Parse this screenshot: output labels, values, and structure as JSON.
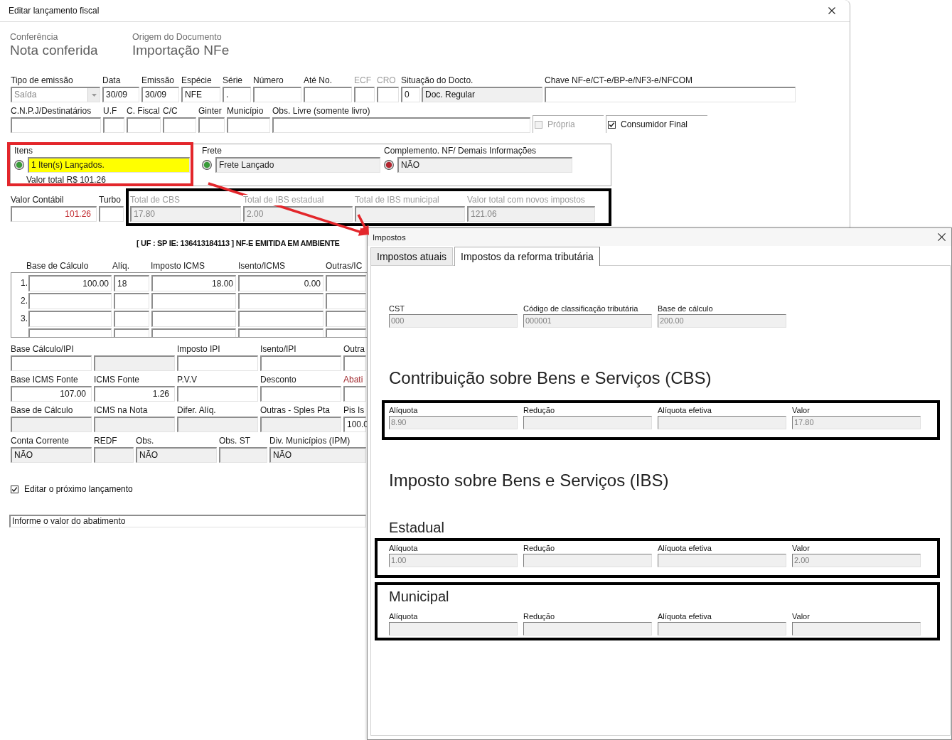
{
  "main_window": {
    "title": "Editar lançamento fiscal",
    "header": [
      {
        "label": "Conferência",
        "value": "Nota conferida"
      },
      {
        "label": "Origem do Documento",
        "value": "Importação NFe"
      }
    ],
    "row_1": [
      {
        "label": "Tipo de emissão",
        "kind": "combo",
        "value": "Saída",
        "disabled": true
      },
      {
        "label": "Data",
        "kind": "input",
        "value": "30/09",
        "disabled": false
      },
      {
        "label": "Emissão",
        "kind": "input",
        "value": "30/09",
        "disabled": false
      },
      {
        "label": "Espécie",
        "kind": "input",
        "value": "NFE",
        "disabled": false
      },
      {
        "label": "Série",
        "kind": "input",
        "value": ".",
        "disabled": false
      },
      {
        "label": "Número",
        "kind": "input",
        "disabled": false
      },
      {
        "label": "Até No.",
        "kind": "input",
        "disabled": false
      },
      {
        "label": "ECF",
        "kind": "input",
        "disabled": true
      },
      {
        "label": "CRO",
        "kind": "input",
        "disabled": true
      },
      {
        "label": "Situação do Docto.",
        "kind": "pair",
        "value": "0",
        "detail": "Doc. Regular",
        "disabled": false
      },
      {
        "label": "Chave NF-e/CT-e/BP-e/NF3-e/NFCOM",
        "kind": "input",
        "disabled": false
      }
    ],
    "row_2": [
      {
        "label": "C.N.P.J/Destinatários",
        "kind": "input"
      },
      {
        "label": "U.F",
        "kind": "input"
      },
      {
        "label": "C. Fiscal",
        "kind": "input"
      },
      {
        "label": "C/C",
        "kind": "input"
      },
      {
        "label": "Ginter",
        "kind": "input"
      },
      {
        "label": "Município",
        "kind": "input"
      },
      {
        "label": "Obs. Livre (somente livro)",
        "kind": "input"
      }
    ],
    "checkboxes": [
      {
        "label": "Própria",
        "checked": false,
        "disabled": true
      },
      {
        "label": "Consumidor Final",
        "checked": true,
        "disabled": false
      }
    ],
    "launch_status": [
      {
        "label": "Itens",
        "value": "1 Iten(s) Lançados.",
        "color": "#3a9b3a",
        "highlighted": true,
        "note": "Valor total R$ 101.26",
        "boxed": true
      },
      {
        "label": "Frete",
        "value": "Frete Lançado",
        "color": "#3a9b3a",
        "highlighted": false,
        "boxed": false
      },
      {
        "label": "Complemento. NF/ Demais Informações",
        "value": "NÃO",
        "color": "#b32630",
        "highlighted": false,
        "boxed": false
      }
    ],
    "values_row": [
      {
        "label": "Valor Contábil",
        "kind": "number",
        "value": "101.26",
        "value_alert": true
      },
      {
        "label": "Turbo",
        "kind": "input"
      }
    ],
    "new_taxes": {
      "boxed": true,
      "fields": [
        {
          "label": "Total de CBS",
          "kind": "readonly",
          "value": "17.80",
          "disabled": true
        },
        {
          "label": "Total de IBS estadual",
          "kind": "readonly",
          "value": "2.00",
          "disabled": true
        },
        {
          "label": "Total de IBS municipal",
          "kind": "readonly",
          "disabled": true
        },
        {
          "label": "Valor total com novos impostos",
          "kind": "readonly",
          "value": "121.06",
          "disabled": true
        }
      ]
    },
    "notice": "[ UF : SP IE: 136413184113 ] NF-E EMITIDA EM AMBIENTE",
    "icms_table": {
      "columns": [
        "Base de Cálculo",
        "Alíq.",
        "Imposto ICMS",
        "Isento/ICMS",
        "Outras/IC"
      ],
      "rows": [
        {
          "number": "1.",
          "cells": [
            "100.00",
            "18",
            "18.00",
            "0.00"
          ],
          "clipped": false
        },
        {
          "number": "2.",
          "clipped": false
        },
        {
          "number": "3.",
          "clipped": false
        },
        {
          "clipped": true
        }
      ]
    },
    "lower_rows": [
      [
        {
          "label": "Base Cálculo/IPI",
          "kind": "input"
        },
        {
          "kind": "readonly"
        },
        {
          "label": "Imposto IPI",
          "kind": "input"
        },
        {
          "label": "Isento/IPI",
          "kind": "input"
        },
        {
          "label": "Outra",
          "kind": "input"
        }
      ],
      [
        {
          "label": "Base ICMS Fonte",
          "kind": "number",
          "value": "107.00",
          "label_alert": false
        },
        {
          "label": "ICMS Fonte",
          "kind": "number",
          "value": "1.26",
          "label_alert": false
        },
        {
          "label": "P.V.V",
          "kind": "input",
          "label_alert": false
        },
        {
          "label": "Desconto",
          "kind": "input",
          "label_alert": false
        },
        {
          "label": "Abati",
          "kind": "input",
          "label_alert": true
        }
      ],
      [
        {
          "label": "Base de Cálculo",
          "kind": "readonly"
        },
        {
          "label": "ICMS na Nota",
          "kind": "readonly"
        },
        {
          "label": "Difer. Alíq.",
          "kind": "readonly"
        },
        {
          "label": "Outras - Sples Pta",
          "kind": "readonly"
        },
        {
          "label": "Pis Is",
          "kind": "input",
          "value": "100.0"
        }
      ],
      [
        {
          "label": "Conta Corrente",
          "kind": "readonly",
          "value": "NÃO"
        },
        {
          "label": "REDF",
          "kind": "readonly"
        },
        {
          "label": "Obs.",
          "kind": "readonly",
          "value": "NÃO"
        },
        {
          "label": "Obs. ST",
          "kind": "readonly"
        },
        {
          "label": "Div. Municípios (IPM)",
          "kind": "readonly",
          "value": "NÃO"
        }
      ]
    ],
    "edit_next": {
      "label": "Editar o próximo lançamento",
      "checked": true
    },
    "status_bar": "Informe o valor do abatimento"
  },
  "taxes_window": {
    "title": "Impostos",
    "tabs": [
      {
        "label": "Impostos atuais",
        "selected": false
      },
      {
        "label": "Impostos da reforma tributária",
        "selected": true
      }
    ],
    "fields": [
      {
        "label": "CST",
        "value": "000",
        "disabled": true
      },
      {
        "label": "Código de classificação tributária",
        "value": "000001",
        "disabled": true
      },
      {
        "label": "Base de cálculo",
        "value": "200.00",
        "disabled": true
      }
    ],
    "sections": [
      {
        "title": "Contribuição sobre Bens e Serviços (CBS)",
        "blocks": [
          {
            "kind": "fields",
            "boxed": true,
            "fields": [
              {
                "label": "Alíquota",
                "value": "8.90",
                "disabled": true
              },
              {
                "label": "Redução",
                "disabled": true
              },
              {
                "label": "Alíquota efetiva",
                "disabled": true
              },
              {
                "label": "Valor",
                "value": "17.80",
                "disabled": true
              }
            ]
          }
        ]
      },
      {
        "title": "Imposto sobre Bens e Serviços (IBS)",
        "blocks": [
          {
            "kind": "subtitle",
            "text": "Estadual"
          },
          {
            "kind": "fields",
            "boxed": true,
            "fields": [
              {
                "label": "Alíquota",
                "value": "1.00",
                "disabled": true
              },
              {
                "label": "Redução",
                "disabled": true
              },
              {
                "label": "Alíquota efetiva",
                "disabled": true
              },
              {
                "label": "Valor",
                "value": "2.00",
                "disabled": true
              }
            ]
          },
          {
            "kind": "fields",
            "boxed": true,
            "title": "Municipal",
            "fields": [
              {
                "label": "Alíquota",
                "disabled": true
              },
              {
                "label": "Redução",
                "disabled": true
              },
              {
                "label": "Alíquota efetiva",
                "disabled": true
              },
              {
                "label": "Valor",
                "disabled": true
              }
            ]
          }
        ]
      }
    ]
  },
  "annotation_arrows": [
    {
      "color": "#e3262b"
    },
    {
      "color": "#e3262b"
    }
  ]
}
